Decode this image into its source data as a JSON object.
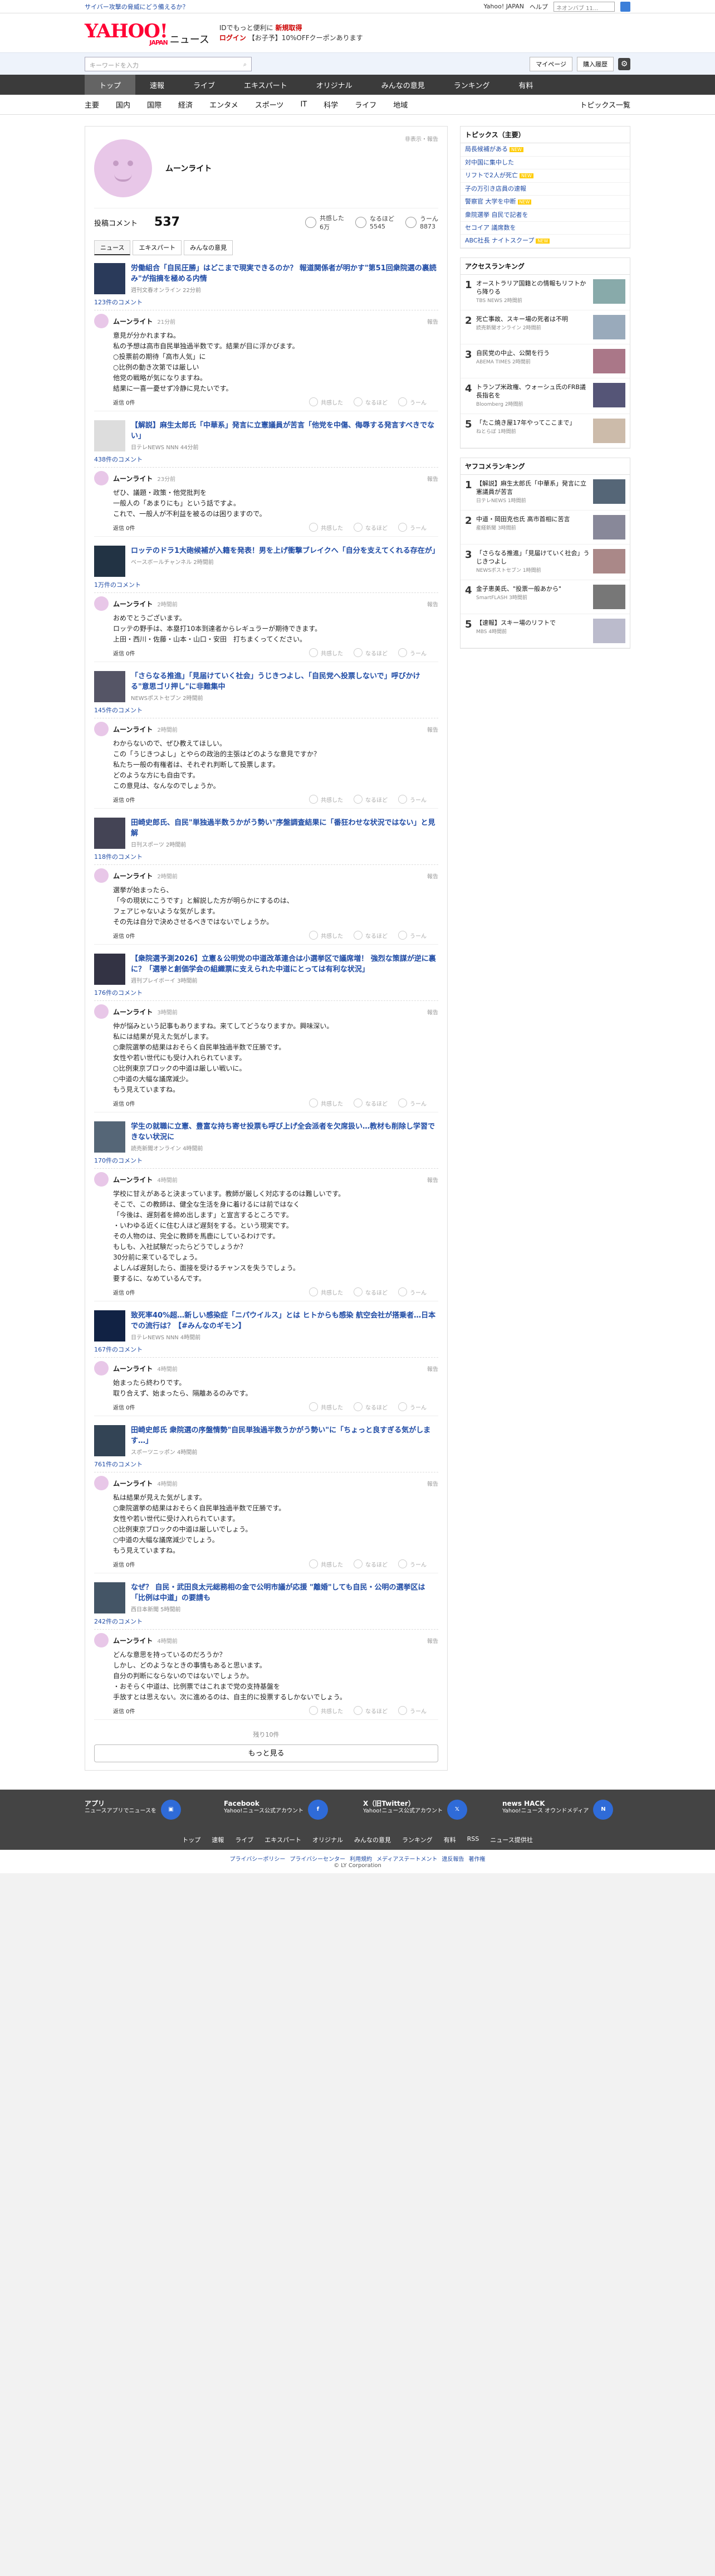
{
  "toplinks": {
    "left": "サイバー攻撃の脅威にどう備えるか？",
    "right_links": [
      "Yahoo! JAPAN",
      "ヘルプ"
    ],
    "search_placeholder": "ウェブ検索",
    "search_value": "ネオンバブ 11..."
  },
  "header": {
    "logo": "YAHOO!",
    "logo_sub": "JAPAN",
    "service": "ニュース",
    "promo_line1": "IDでもっと便利に",
    "promo_link": "新規取得",
    "promo_line2": "ログイン",
    "promo_line3": "【お子予】10%OFFクーポンあります"
  },
  "searchbar": {
    "placeholder": "キーワードを入力",
    "mypage": "マイページ",
    "purchase": "購入履歴"
  },
  "gnav": [
    "トップ",
    "速報",
    "ライブ",
    "エキスパート",
    "オリジナル",
    "みんなの意見",
    "ランキング",
    "有料"
  ],
  "subnav": [
    "主要",
    "国内",
    "国際",
    "経済",
    "エンタメ",
    "スポーツ",
    "IT",
    "科学",
    "ライフ",
    "地域"
  ],
  "subnav_last": "トピックス一覧",
  "profile": {
    "name": "ムーンライト",
    "report": "非表示・報告",
    "comments_label": "投稿コメント",
    "comments": "537",
    "stats": [
      {
        "label": "共感した",
        "value": "6万"
      },
      {
        "label": "なるほど",
        "value": "5545"
      },
      {
        "label": "うーん",
        "value": "8873"
      }
    ]
  },
  "tabs": [
    "ニュース",
    "エキスパート",
    "みんなの意見"
  ],
  "comments": [
    {
      "title": "労働組合「自民圧勝」はどこまで現実できるのか？ 報道関係者が明かす\"第51回衆院選の裏読み\"が指摘を極める内情",
      "source": "週刊文春オンライン 22分前",
      "count": "123件のコメント",
      "time": "21分前",
      "text": "意見が分かれますね。\n私の予想は高市自民単独過半数です。結果が目に浮かびます。\n○投票前の期待「高市人気」に\n○比例の動き次第では厳しい\n他党の戦略が気になりますね。\n結果に一喜一憂せず冷静に見たいです。",
      "rep": "返信 0件"
    },
    {
      "title": "【解説】麻生太郎氏「中華系」発言に立憲議員が苦言「他党を中傷、侮辱する発言すべきでない」",
      "source": "日テレNEWS NNN 44分前",
      "count": "438件のコメント",
      "time": "23分前",
      "text": "ぜひ、議題・政策・他党批判を\n一般人の「あまりにも」という話ですよ。\nこれで、一般人が不利益を被るのは困りますので。",
      "rep": "返信 0件"
    },
    {
      "title": "ロッテのドラ1大砲候補が入籍を発表！男を上げ衝撃ブレイクへ「自分を支えてくれる存在が」",
      "source": "ベースボールチャンネル 2時間前",
      "count": "1万件のコメント",
      "time": "2時間前",
      "text": "おめでとうございます。\nロッテの野手は、本塁打10本到達者からレギュラーが期待できます。\n上田・西川・佐藤・山本・山口・安田　打ちまくってください。",
      "rep": "返信 0件"
    },
    {
      "title": "「さらなる推進」「見届けていく社会」うじきつよし、「自民党へ投票しないで」呼びかける\"意思ゴリ押し\"に非難集中",
      "source": "NEWSポストセブン 2時間前",
      "count": "145件のコメント",
      "time": "2時間前",
      "text": "わからないので、ぜひ教えてほしい。\nこの「うじきつよし」とやらの政治的主張はどのような意見ですか？\n私たち一般の有権者は、それぞれ判断して投票します。\nどのような方にも自由です。\nこの意見は、なんなのでしょうか。",
      "rep": "返信 0件"
    },
    {
      "title": "田崎史郎氏、自民\"単独過半数うかがう勢い\"序盤調査結果に「番狂わせな状況ではない」と見解",
      "source": "日刊スポーツ 2時間前",
      "count": "118件のコメント",
      "time": "2時間前",
      "text": "選挙が始まったら、\n「今の現状にこうです」と解説した方が明らかにするのは、\nフェアじゃないような気がします。\nその先は自分で決めさせるべきではないでしょうか。",
      "rep": "返信 0件"
    },
    {
      "title": "【衆院選予測2026】立憲＆公明党の中道改革連合は小選挙区で議席増！ 強烈な策謀が逆に裏に？「選挙と創価学会の組織票に支えられた中道にとっては有利な状況」",
      "source": "週刊プレイボーイ 3時間前",
      "count": "176件のコメント",
      "time": "3時間前",
      "text": "仲が悩みという記事もありますね。来てしてどうなりますか。興味深い。\n私には結果が見えた気がします。\n○衆院選挙の結果はおそらく自民単独過半数で圧勝です。\n女性や若い世代にも受け入れられています。\n○比例東京ブロックの中道は厳しい戦いに。\n○中道の大幅な議席減少。\nもう見えていますね。",
      "rep": "返信 0件"
    },
    {
      "title": "学生の就職に立憲、豊富な持ち寄せ投票も呼び上げ全会派者を欠席扱い…教材も削除し学習できない状況に",
      "source": "読売新聞オンライン 4時間前",
      "count": "170件のコメント",
      "time": "4時間前",
      "text": "学校に甘えがあると決まっています。教師が厳しく対応するのは難しいです。\nそこで、この教師は、健全な生活を身に着けるには前ではなく\n「今後は、遅刻者を締め出します」と宣言するところです。\n・いわゆる近くに住む人ほど遅刻をする。という現実です。\nその人物のは、完全に教師を馬鹿にしているわけです。\nもしも、入社試験だったらどうでしょうか？\n30分前に来ているでしょう。\nよしんば遅刻したら、面接を受けるチャンスを失うでしょう。\n要するに、なめているんです。",
      "rep": "返信 0件"
    },
    {
      "title": "致死率40%超…新しい感染症「ニパウイルス」とは ヒトからも感染 航空会社が搭乗者…日本での流行は？【#みんなのギモン】",
      "source": "日テレNEWS NNN 4時間前",
      "count": "167件のコメント",
      "time": "4時間前",
      "text": "始まったら終わりです。\n取り合えず、始まったら、隔離あるのみです。",
      "rep": "返信 0件"
    },
    {
      "title": "田崎史郎氏 衆院選の序盤情勢\"自民単独過半数うかがう勢い\"に「ちょっと良すぎる気がします…」",
      "source": "スポーツニッポン 4時間前",
      "count": "761件のコメント",
      "time": "4時間前",
      "text": "私は結果が見えた気がします。\n○衆院選挙の結果はおそらく自民単独過半数で圧勝です。\n女性や若い世代に受け入れられています。\n○比例東京ブロックの中道は厳しいでしょう。\n○中道の大幅な議席減少でしょう。\nもう見えていますね。",
      "rep": "返信 0件"
    },
    {
      "title": "なぜ？ 自民・武田良太元総務相の金で公明市議が応援 \"離婚\"しても自民・公明の選挙区は「比例は中道」の要請も",
      "source": "西日本新聞 5時間前",
      "count": "242件のコメント",
      "time": "4時間前",
      "text": "どんな意思を持っているのだろうか？\nしかし、どのようなときの事情もあると思います。\n自分の判断にならないのではないでしょうか。\n・おそらく中道は、比例票ではこれまで党の支持基盤を\n手放すとは思えない。次に進めるのは、自主的に投票するしかないでしょう。",
      "rep": "返信 0件"
    }
  ],
  "reactions": [
    "共感した",
    "なるほど",
    "うーん"
  ],
  "report_label": "報告",
  "more": {
    "count_text": "残り10件",
    "button": "もっと見る"
  },
  "sidebar": {
    "topics_title": "トピックス（主要）",
    "topics": [
      {
        "t": "局長候補がある",
        "new": true
      },
      {
        "t": "対中国に集中した",
        "new": false
      },
      {
        "t": "リフトで2人が死亡",
        "new": true
      },
      {
        "t": "子の万引き店員の速報",
        "new": false
      },
      {
        "t": "警察官 大学を中断",
        "new": true
      },
      {
        "t": "衆院選挙 自民で記者を",
        "new": false
      },
      {
        "t": "セコイア 議席数を",
        "new": false
      },
      {
        "t": "ABC社長 ナイトスクープ",
        "new": true
      }
    ],
    "access_title": "アクセスランキング",
    "access": [
      {
        "t": "オーストラリア国籍との情報もリフトから降りる",
        "s": "TBS NEWS 2時間前"
      },
      {
        "t": "死亡事故、スキー場の死者は不明",
        "s": "読売新聞オンライン 2時間前"
      },
      {
        "t": "自民党の中止、公開を行う",
        "s": "ABEMA TIMES 2時間前"
      },
      {
        "t": "トランプ米政権、ウォーシュ氏のFRB議長指名を",
        "s": "Bloomberg 2時間前"
      },
      {
        "t": "「たこ焼き屋17年やってここまで」",
        "s": "ねとらぼ 1時間前"
      }
    ],
    "yahoo_title": "ヤフコメランキング",
    "yahoo": [
      {
        "t": "【解説】麻生太郎氏「中華系」発言に立憲議員が苦言",
        "s": "日テレNEWS 1時間前"
      },
      {
        "t": "中道・岡田克也氏 高市首相に苦言",
        "s": "産経新聞 3時間前"
      },
      {
        "t": "「さらなる推進」「見届けていく社会」うじきつよし",
        "s": "NEWSポストセブン 1時間前"
      },
      {
        "t": "金子恵美氏、\"投票一般あから\"",
        "s": "SmartFLASH 3時間前"
      },
      {
        "t": "【速報】スキー場のリフトで",
        "s": "MBS 4時間前"
      }
    ]
  },
  "footer": {
    "cols": [
      {
        "t": "アプリ",
        "d": "ニュースアプリでニュースを"
      },
      {
        "t": "Facebook",
        "d": "Yahoo!ニュース公式アカウント"
      },
      {
        "t": "X（旧Twitter）",
        "d": "Yahoo!ニュース公式アカウント"
      },
      {
        "t": "news HACK",
        "d": "Yahoo!ニュース オウンドメディア"
      }
    ],
    "nav": [
      "トップ",
      "速報",
      "ライブ",
      "エキスパート",
      "オリジナル",
      "みんなの意見",
      "ランキング",
      "有料",
      "RSS",
      "ニュース提供社"
    ],
    "links": [
      "プライバシーポリシー",
      "プライバシーセンター",
      "利用規約",
      "メディアステートメント",
      "違反報告",
      "著作権"
    ],
    "copyright": "© LY Corporation"
  }
}
